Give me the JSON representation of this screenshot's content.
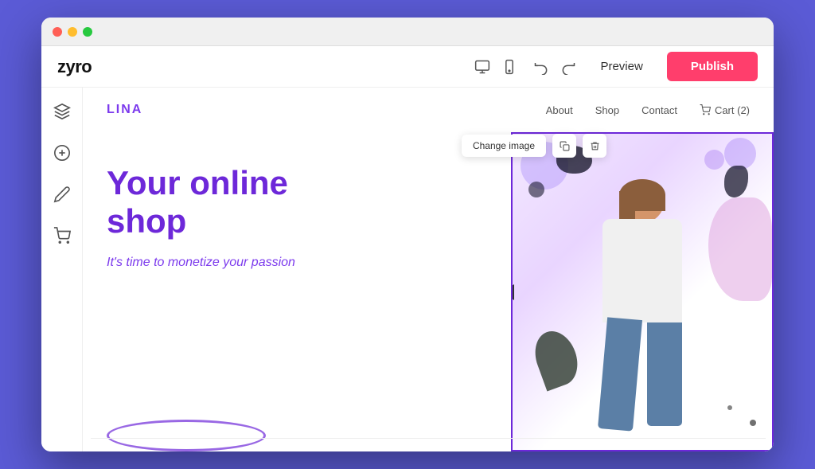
{
  "browser": {
    "traffic_lights": [
      "red",
      "yellow",
      "green"
    ]
  },
  "toolbar": {
    "logo": "zyro",
    "device_desktop_label": "desktop",
    "device_mobile_label": "mobile",
    "undo_label": "undo",
    "redo_label": "redo",
    "preview_label": "Preview",
    "publish_label": "Publish"
  },
  "sidebar": {
    "items": [
      {
        "name": "layers",
        "label": "Layers"
      },
      {
        "name": "add",
        "label": "Add"
      },
      {
        "name": "design",
        "label": "Design"
      },
      {
        "name": "cart",
        "label": "Cart"
      }
    ]
  },
  "site": {
    "brand": "LINA",
    "nav_links": [
      "About",
      "Shop",
      "Contact"
    ],
    "cart_label": "Cart (2)",
    "hero_title": "Your online\nshop",
    "hero_subtitle": "It's time to monetize your passion",
    "change_image_label": "Change image"
  },
  "colors": {
    "purple": "#6d28d9",
    "purple_light": "#7c3aed",
    "pink": "#ff3e6c",
    "bg": "#fff"
  }
}
